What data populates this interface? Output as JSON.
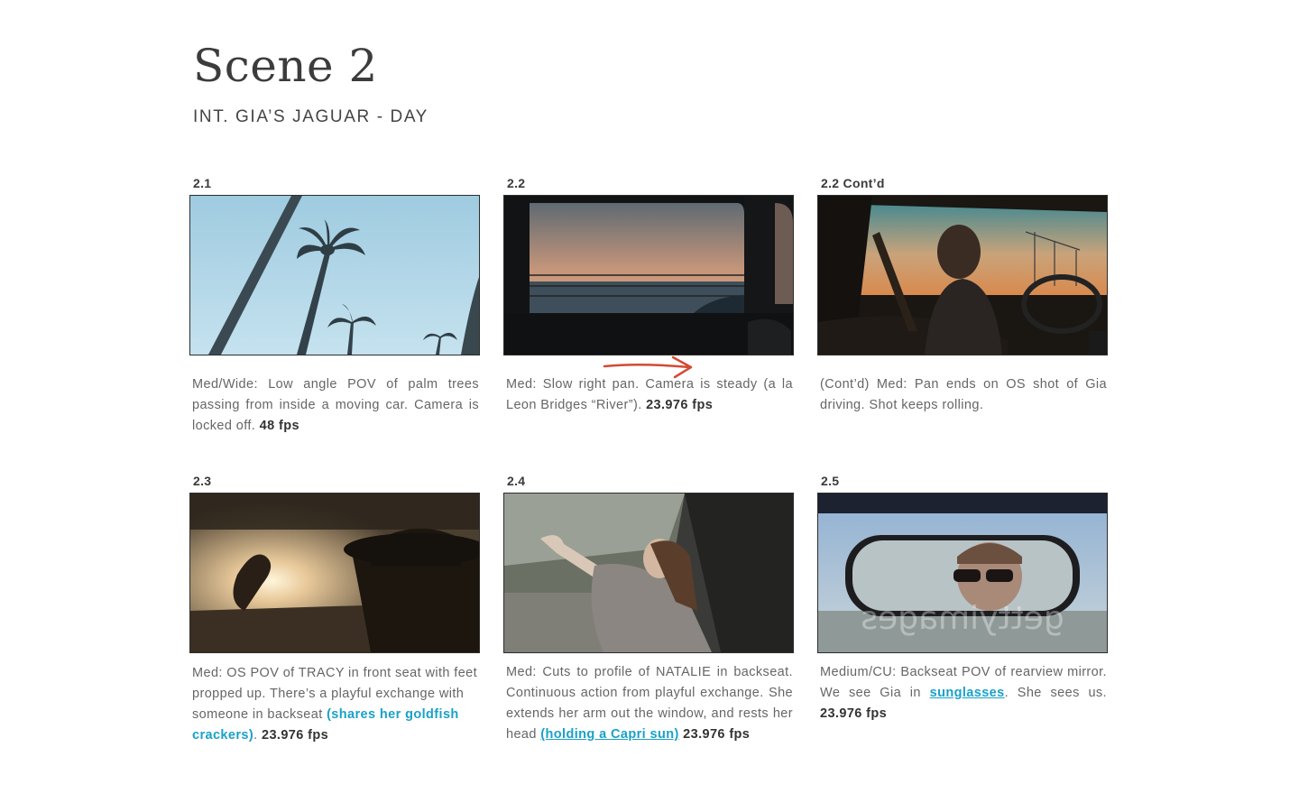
{
  "scene": {
    "title": "Scene 2",
    "subtitle": "INT. GIA’S JAGUAR - DAY"
  },
  "panels": [
    {
      "number": "2.1",
      "image_alt": "Low angle view of palm trees against blue sky",
      "desc_text": "Med/Wide: Low angle POV of palm trees  passing from inside a moving car. Camera is locked off.",
      "fps": "48 fps"
    },
    {
      "number": "2.2",
      "image_alt": "Car window view of sunset over water",
      "desc_text": "Med: Slow right pan. Camera is steady (a la Leon Bridges “River”).",
      "fps": "23.976 fps"
    },
    {
      "number": "2.2 Cont’d",
      "image_alt": "Gia driving at sunset",
      "desc_text": "(Cont’d) Med: Pan ends on OS shot of Gia driving. Shot keeps rolling.",
      "fps": ""
    },
    {
      "number": "2.3",
      "image_alt": "Over shoulder view of feet propped up in front seat",
      "desc_text": "Med: OS POV of TRACY in front seat with feet propped up. There’s a playful exchange with someone in backseat",
      "link": "(shares her goldfish crackers)",
      "after_link": ".",
      "fps": "23.976 fps"
    },
    {
      "number": "2.4",
      "image_alt": "Natalie in backseat extending arm out window",
      "desc_text": "Med: Cuts to profile of NATALIE in backseat. Continuous action from playful exchange. She extends her arm out the window, and rests her head",
      "link": "(holding a Capri sun)",
      "after_link": "",
      "fps": "23.976 fps"
    },
    {
      "number": "2.5",
      "image_alt": "Gia in sunglasses seen in rearview mirror",
      "desc_pre": "Medium/CU: Backseat POV of rearview mirror. We see Gia in",
      "link": "sunglasses",
      "desc_post": ". She sees us.",
      "fps": "23.976 fps",
      "watermark": "gettyimages"
    }
  ]
}
